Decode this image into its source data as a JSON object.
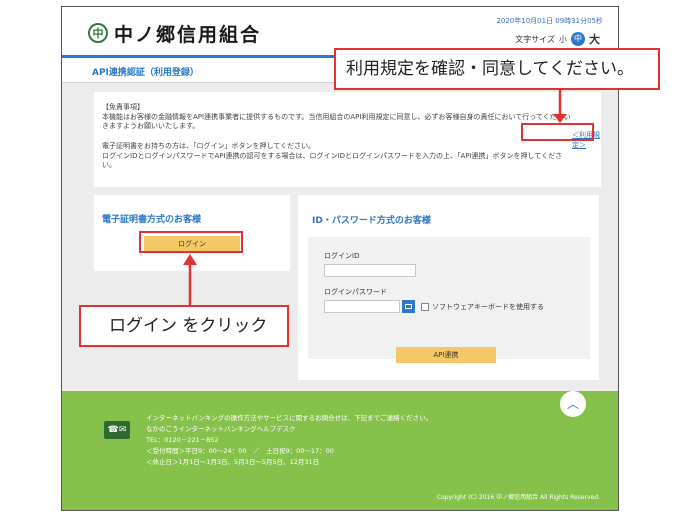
{
  "header": {
    "logo_glyph": "中",
    "bank_name": "中ノ郷信用組合",
    "datetime": "2020年10月01日 09時31分05秒",
    "font_size_label": "文字サイズ",
    "font_small": "小",
    "font_medium": "中",
    "font_large": "大"
  },
  "page": {
    "title": "API連携認証（利用登録）"
  },
  "notice": {
    "line1": "【免責事項】",
    "line2": "本機能はお客様の金融情報をAPI連携事業者に提供するものです。当信用組合のAPI利用規定に同意し、必ずお客様自身の責任において行ってください",
    "line3": "きますようお願いいたします。",
    "line4": "電子証明書をお持ちの方は、「ログイン」ボタンを押してください。",
    "line5": "ログインIDとログインパスワードでAPI連携の認可をする場合は、ログインIDとログインパスワードを入力の上、「API連携」ボタンを押してくださ",
    "line6": "い。",
    "terms_link": "＜利用規定＞"
  },
  "cert_panel": {
    "title": "電子証明書方式のお客様",
    "login_button": "ログイン"
  },
  "id_panel": {
    "title": "ID・パスワード方式のお客様",
    "login_id_label": "ログインID",
    "login_id_value": "",
    "password_label": "ログインパスワード",
    "password_value": "",
    "software_keyboard_label": "ソフトウェアキーボードを使用する",
    "api_button": "API連携"
  },
  "footer": {
    "phone_glyph": "☎✉",
    "line1": "インターネットバンキングの操作方法やサービスに関するお問合せは、下記までご連絡ください。",
    "line2": "なかのごうインターネットバンキングヘルプデスク",
    "line3": "TEL：0120－221－852",
    "line4": "＜受付時間＞平日9：00～24：00　／　土日祝9：00～17：00",
    "line5": "＜休止日＞1月1日～1月3日、5月3日～5月5日、12月31日",
    "copyright": "Copyright (C) 2016 中ノ郷信用組合 All Rights Reserved.",
    "pagetop_glyph": "︿"
  },
  "annotations": {
    "terms_callout": "利用規定を確認・同意してください。",
    "login_callout": "ログイン をクリック"
  },
  "colors": {
    "accent": "#2d78c8",
    "button": "#f6c766",
    "footer": "#86c24b",
    "annotation": "#e23131"
  }
}
